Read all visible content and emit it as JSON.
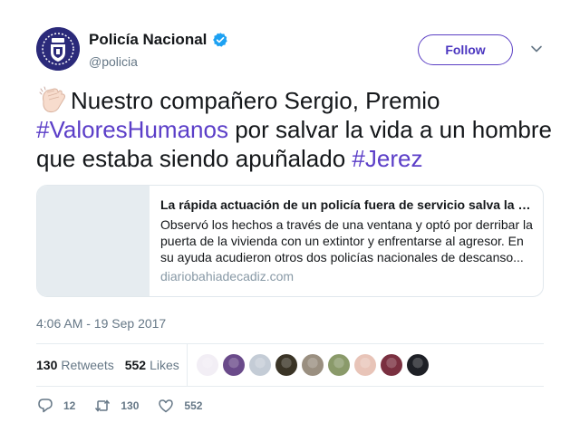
{
  "header": {
    "display_name": "Policía Nacional",
    "handle": "@policia",
    "verified": true,
    "follow_label": "Follow",
    "avatar_icon": "police-badge-icon",
    "verified_color": "#1da1f2"
  },
  "tweet": {
    "emoji_icon": "clapping-hands-icon",
    "text_part1": "Nuestro compañero Sergio, Premio ",
    "hashtag1": "#ValoresHumanos",
    "text_part2": " por salvar la vida a un hombre que estaba siendo apuñalado ",
    "hashtag2": "#Jerez",
    "hashtag_color": "#5b3ec8"
  },
  "card": {
    "title": "La rápida actuación de un policía fuera de servicio salva la …",
    "description": "Observó los hechos a través de una ventana y optó por derribar la puerta de la vivienda con un extintor y enfrentarse al agresor. En su ayuda acudieron otros dos policías nacionales de descanso...",
    "domain": "diariobahiadecadiz.com"
  },
  "timestamp": "4:06 AM - 19 Sep 2017",
  "stats": {
    "retweets_count": "130",
    "retweets_label": "Retweets",
    "likes_count": "552",
    "likes_label": "Likes"
  },
  "likers": [
    {
      "color": "#f2eef5"
    },
    {
      "color": "#6a4a8a"
    },
    {
      "color": "#c4ccd6"
    },
    {
      "color": "#3a3426"
    },
    {
      "color": "#9a8f80"
    },
    {
      "color": "#8a9a6a"
    },
    {
      "color": "#e8c4b8"
    },
    {
      "color": "#7a3040"
    },
    {
      "color": "#1e2026"
    }
  ],
  "actions": {
    "reply_count": "12",
    "retweet_count": "130",
    "like_count": "552"
  }
}
